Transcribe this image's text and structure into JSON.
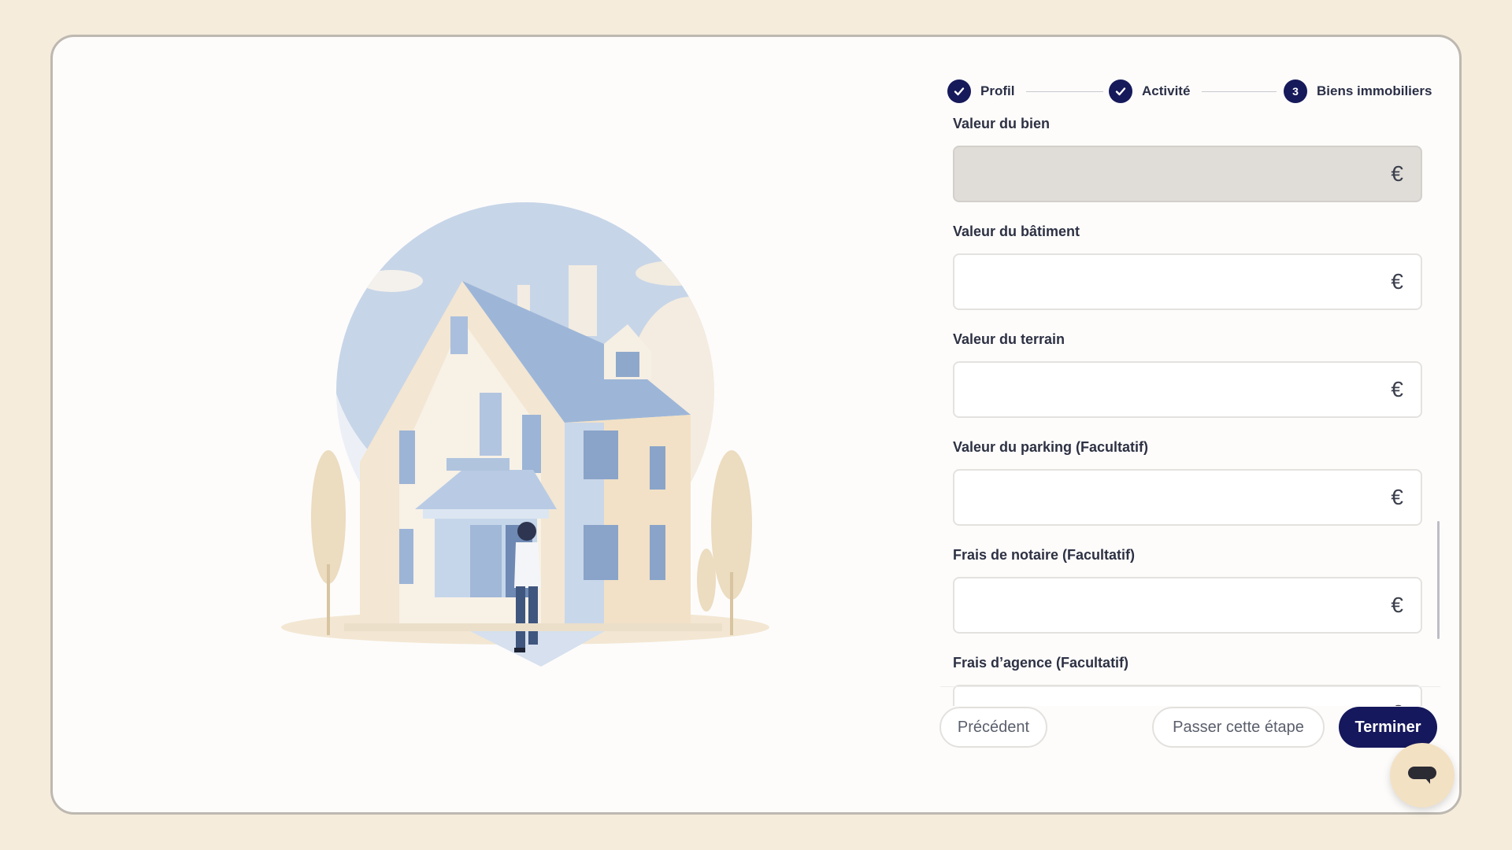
{
  "stepper": {
    "steps": [
      {
        "label": "Profil",
        "status": "done"
      },
      {
        "label": "Activité",
        "status": "done"
      },
      {
        "number": "3",
        "label": "Biens immobiliers",
        "status": "current"
      }
    ]
  },
  "form": {
    "currency_symbol": "€",
    "fields": [
      {
        "label": "Valeur du bien",
        "value": "",
        "disabled": true
      },
      {
        "label": "Valeur du bâtiment",
        "value": ""
      },
      {
        "label": "Valeur du terrain",
        "value": ""
      },
      {
        "label": "Valeur du parking (Facultatif)",
        "value": ""
      },
      {
        "label": "Frais de notaire (Facultatif)",
        "value": ""
      },
      {
        "label": "Frais d’agence (Facultatif)",
        "value": ""
      }
    ]
  },
  "actions": {
    "previous": "Précédent",
    "skip": "Passer cette étape",
    "finish": "Terminer"
  },
  "icons": {
    "check": "check-icon",
    "euro": "euro-icon",
    "chat": "chat-icon",
    "illustration": "house-illustration"
  },
  "colors": {
    "primary": "#15185c",
    "background": "#f5ecdc",
    "disabled_input": "#e0ddd8",
    "chat_button": "#f3e1c4"
  }
}
